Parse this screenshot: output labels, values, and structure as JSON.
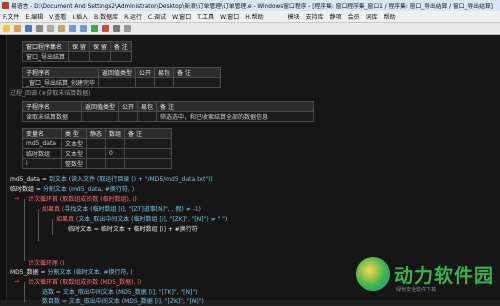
{
  "window": {
    "title": "易语言 - D:\\Document And Settings2\\Administrator\\Desktop\\新浪\\订单管理\\订单管理.e - Windows窗口程序 - [程序集: 窗口程序集_窗口1 / 程序集: 窗口_导出结算 / 窗口_导出结算]"
  },
  "menu": {
    "items": [
      "F.文件",
      "E.编辑",
      "V.查看",
      "I.插入",
      "B.数据库",
      "R.运行",
      "C.调试",
      "W.窗口",
      "T.工具",
      "W.窗口",
      "H.帮助"
    ],
    "right_items": [
      "模块",
      "支持库",
      "静项",
      "会员",
      "词库",
      "帮助"
    ]
  },
  "editor": {
    "t1": {
      "headers": [
        "窗口程序集名",
        "保 留",
        "保 留",
        "备 注"
      ],
      "row": [
        "窗口_导出结算",
        "",
        "",
        ""
      ]
    },
    "t2": {
      "headers": [
        "子程序名",
        "返回值类型",
        "公开",
        "易包",
        "备 注"
      ],
      "row": [
        "_窗口_导出结算_创建完毕",
        "",
        "",
        "",
        ""
      ]
    },
    "comment1": "过程_回调 (※获取未结算数据)",
    "t3": {
      "headers": [
        "子程序名",
        "返回值类型",
        "公开",
        "易包",
        "备 注"
      ],
      "row": [
        "读取未结算数据",
        "",
        "",
        "",
        "筛选选中，和已收索结算全部的数据信息"
      ]
    },
    "t4": {
      "headers": [
        "变量名",
        "类 型",
        "静态",
        "数组",
        "备 注"
      ],
      "rows": [
        [
          "md5_data",
          "文本型",
          "",
          "",
          ""
        ],
        [
          "临时数组",
          "文本型",
          "",
          "0",
          ""
        ],
        [
          "i",
          "整数型",
          "",
          "",
          ""
        ]
      ]
    },
    "lines": {
      "l1a": "md5_data = ",
      "l1b": "到文本 (读入文件 (取运行目录 () + \"/MD5/md5_data.txt\"))",
      "l2a": "临时数组 = ",
      "l2b": "分割文本 (md5_data, #换行符, )",
      "l3": "计次循环首 (取数组成员数 (临时数组), i)",
      "l4a": "如果真 (",
      "l4b": "寻找文本 (临时数组 [i], \"[ZT]道事[N]\", , 假) ≠ -1)",
      "l5a": "如果真 (",
      "l5b": "文本_取出中间文本 (临时数组 [i], \"[ZK]\", \"[N]\") ≠ \" \")",
      "l6": "临时文本 = 临时文本 + 临时数组 [i] + #换行符",
      "l7": "计次循环尾 ()",
      "l8a": "MD5_数据 = ",
      "l8b": "分割文本 (临时文本, #换行符, )",
      "l9": "计次循环首 (取数组成员数 (MD5_数据), i)",
      "l10": "选数 = 文本_取出中间文本 (MD5_数据 [i], \"[TK]\", \"[N]\")",
      "l11": "数目数 = 文本_取出中间文本 (MD5_数据 [i], \"[ZK]\", \"[N]\")"
    }
  },
  "watermark": {
    "brand": "动力软件园",
    "sub": "绿色安全软件下载"
  },
  "colors": {
    "keyword": "#e8e8e8",
    "function": "#7bd88f",
    "string": "#6fc3df",
    "flow": "#ff6b6b",
    "background": "#161616"
  }
}
